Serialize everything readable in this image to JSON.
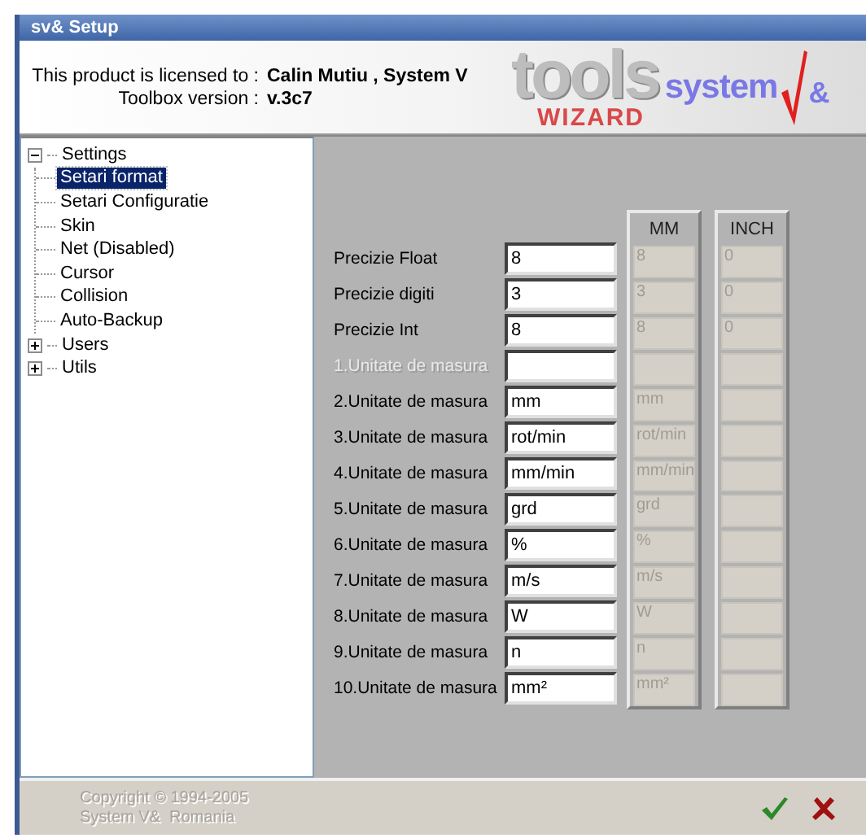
{
  "window": {
    "title": "sv& Setup"
  },
  "header": {
    "license_label": "This product is licensed to :",
    "license_value": "Calin Mutiu , System V",
    "version_label": "Toolbox version :",
    "version_value": "v.3c7",
    "logo": {
      "tools": "tools",
      "wizard": "WIZARD",
      "system": "system",
      "amp": "&"
    }
  },
  "tree": [
    {
      "label": "Settings",
      "expanded": true,
      "selected": false,
      "children": [
        {
          "label": "Setari format",
          "selected": true
        },
        {
          "label": "Setari Configuratie",
          "selected": false
        },
        {
          "label": "Skin",
          "selected": false
        },
        {
          "label": "Net (Disabled)",
          "selected": false
        },
        {
          "label": "Cursor",
          "selected": false
        },
        {
          "label": "Collision",
          "selected": false
        },
        {
          "label": "Auto-Backup",
          "selected": false
        }
      ]
    },
    {
      "label": "Users",
      "expanded": false,
      "selected": false
    },
    {
      "label": "Utils",
      "expanded": false,
      "selected": false
    }
  ],
  "form": {
    "mm_header": "MM",
    "inch_header": "INCH",
    "rows": [
      {
        "label": "Precizie Float",
        "value": "8",
        "mm": "8",
        "inch": "0",
        "disabled": false
      },
      {
        "label": "Precizie digiti",
        "value": "3",
        "mm": "3",
        "inch": "0",
        "disabled": false
      },
      {
        "label": "Precizie Int",
        "value": "8",
        "mm": "8",
        "inch": "0",
        "disabled": false
      },
      {
        "label": "1.Unitate de masura",
        "disabled": true
      },
      {
        "label": "2.Unitate de masura",
        "value": "mm",
        "mm": "mm",
        "disabled": false
      },
      {
        "label": "3.Unitate de masura",
        "value": "rot/min",
        "mm": "rot/min",
        "disabled": false
      },
      {
        "label": "4.Unitate de masura",
        "value": "mm/min",
        "mm": "mm/min",
        "disabled": false
      },
      {
        "label": "5.Unitate de masura",
        "value": "grd",
        "mm": "grd",
        "disabled": false
      },
      {
        "label": "6.Unitate de masura",
        "value": "%",
        "mm": "%",
        "disabled": false
      },
      {
        "label": "7.Unitate de masura",
        "value": "m/s",
        "mm": "m/s",
        "disabled": false
      },
      {
        "label": "8.Unitate de masura",
        "value": "W",
        "mm": "W",
        "disabled": false
      },
      {
        "label": "9.Unitate de masura",
        "value": "n",
        "mm": "n",
        "disabled": false
      },
      {
        "label": "10.Unitate de masura",
        "value": "mm²",
        "mm": "mm²",
        "disabled": false
      }
    ]
  },
  "footer": {
    "copyright": "Copyright © 1994-2005",
    "company": "System V&  Romania"
  }
}
